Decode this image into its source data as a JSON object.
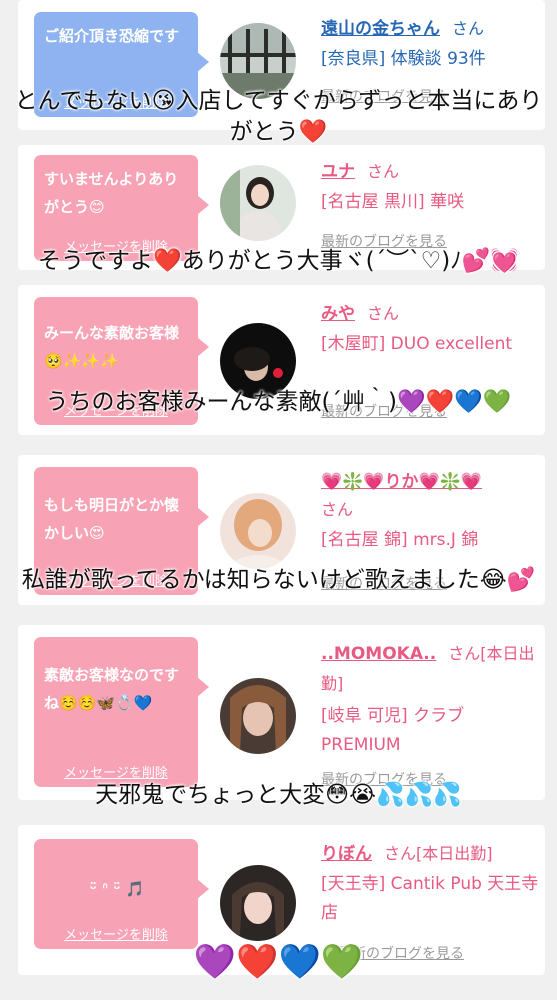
{
  "cards": [
    {
      "message": "ご紹介頂き恐縮です",
      "delete_label": "メッセージを削除",
      "name": "遠山の金ちゃん",
      "san": "さん",
      "details": "[奈良県] 体験談 93件",
      "blog_label": "最新のブログを見る"
    },
    {
      "message": "すいませんよりありがとう😊",
      "delete_label": "メッセージを削除",
      "name": "ユナ",
      "san": "さん",
      "details": "[名古屋 黒川] 華咲",
      "blog_label": "最新のブログを見る"
    },
    {
      "message": "みーんな素敵お客様🥺✨✨✨",
      "delete_label": "メッセージを削除",
      "name": "みや",
      "san": "さん",
      "details": "[木屋町] DUO excellent",
      "blog_label": "最新のブログを見る"
    },
    {
      "message": "もしも明日がとか懐かしい😍",
      "delete_label": "メッセージを削除",
      "name": "💗❇️💗りか💗❇️💗",
      "san": "さん",
      "details": "[名古屋 錦] mrs.J 錦",
      "blog_label": "最新のブログを見る"
    },
    {
      "message": "素敵お客様なのですね☺️☺️🦋💍💙",
      "delete_label": "メッセージを削除",
      "name": "..MOMOKA..",
      "san": "さん[本日出勤]",
      "details": "[岐阜 可児] クラブ PREMIUM",
      "blog_label": "最新のブログを見る"
    },
    {
      "message": "ᵕ̈ ᐢ ᵕ̈ 🎵",
      "delete_label": "メッセージを削除",
      "name": "りぼん",
      "san": "さん[本日出勤]",
      "details": "[天王寺] Cantik Pub 天王寺店",
      "blog_label": "最新のブログを見る"
    }
  ],
  "overlays": [
    "とんでもない😘入店してすぐからずっと本当にありがとう❤️",
    "そうですよ❤️ありがとう大事ヾ(´︶`♡)ﾉ💕💓",
    "うちのお客様みーんな素敵(´艸｀)💜❤️💙💚",
    "私誰が歌ってるかは知らないけど歌えました😂💕",
    "天邪鬼でちょっと大変😳😭💦💦💦",
    "💜❤️💙💚"
  ],
  "colors": {
    "blue_bubble": "#8fb3f0",
    "pink_bubble": "#f8a3b5",
    "blue_text": "#2667b5",
    "pink_text": "#e85a81"
  }
}
